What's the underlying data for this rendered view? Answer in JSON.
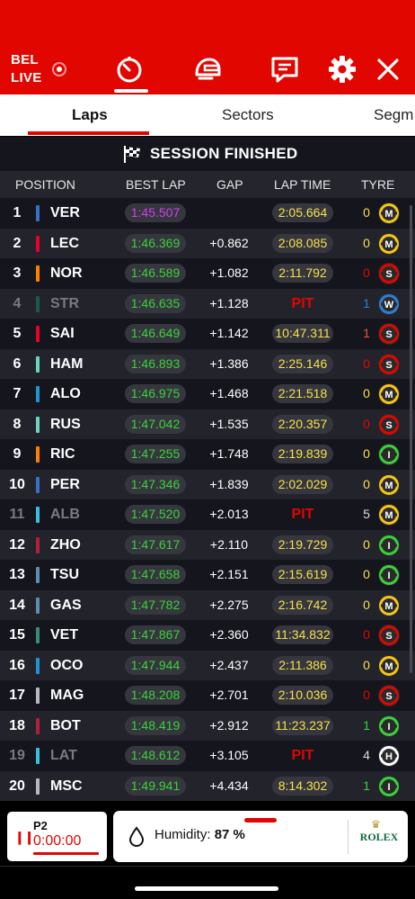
{
  "header": {
    "location": "BEL",
    "live_label": "LIVE",
    "icons": [
      "timer-icon",
      "helmet-icon",
      "chat-icon",
      "gear-icon",
      "close-icon"
    ]
  },
  "tabs": [
    {
      "label": "Laps",
      "active": true
    },
    {
      "label": "Sectors",
      "active": false
    },
    {
      "label": "Segm",
      "active": false
    }
  ],
  "session_status": "SESSION FINISHED",
  "table": {
    "columns": [
      "POSITION",
      "BEST LAP",
      "GAP",
      "LAP TIME",
      "TYRE"
    ],
    "rows": [
      {
        "pos": "1",
        "driver": "VER",
        "team_color": "#3671c6",
        "best": "1:45.507",
        "best_purple": true,
        "gap": "",
        "lap_time": "2:05.664",
        "pit": false,
        "tyre_laps": "0",
        "tyre": "M",
        "dim": false
      },
      {
        "pos": "2",
        "driver": "LEC",
        "team_color": "#e8002d",
        "best": "1:46.369",
        "best_purple": false,
        "gap": "+0.862",
        "lap_time": "2:08.085",
        "pit": false,
        "tyre_laps": "0",
        "tyre": "M",
        "dim": false
      },
      {
        "pos": "3",
        "driver": "NOR",
        "team_color": "#ff8000",
        "best": "1:46.589",
        "best_purple": false,
        "gap": "+1.082",
        "lap_time": "2:11.792",
        "pit": false,
        "tyre_laps": "0",
        "tyre": "S",
        "dim": false
      },
      {
        "pos": "4",
        "driver": "STR",
        "team_color": "#1a5a46",
        "best": "1:46.635",
        "best_purple": false,
        "gap": "+1.128",
        "lap_time": "PIT",
        "pit": true,
        "tyre_laps": "1",
        "tyre": "W",
        "dim": true
      },
      {
        "pos": "5",
        "driver": "SAI",
        "team_color": "#e8002d",
        "best": "1:46.649",
        "best_purple": false,
        "gap": "+1.142",
        "lap_time": "10:47.311",
        "pit": false,
        "tyre_laps": "1",
        "tyre": "S",
        "dim": false
      },
      {
        "pos": "6",
        "driver": "HAM",
        "team_color": "#6cd3bf",
        "best": "1:46.893",
        "best_purple": false,
        "gap": "+1.386",
        "lap_time": "2:25.146",
        "pit": false,
        "tyre_laps": "0",
        "tyre": "S",
        "dim": false
      },
      {
        "pos": "7",
        "driver": "ALO",
        "team_color": "#2293d1",
        "best": "1:46.975",
        "best_purple": false,
        "gap": "+1.468",
        "lap_time": "2:21.518",
        "pit": false,
        "tyre_laps": "0",
        "tyre": "M",
        "dim": false
      },
      {
        "pos": "8",
        "driver": "RUS",
        "team_color": "#6cd3bf",
        "best": "1:47.042",
        "best_purple": false,
        "gap": "+1.535",
        "lap_time": "2:20.357",
        "pit": false,
        "tyre_laps": "0",
        "tyre": "S",
        "dim": false
      },
      {
        "pos": "9",
        "driver": "RIC",
        "team_color": "#ff8000",
        "best": "1:47.255",
        "best_purple": false,
        "gap": "+1.748",
        "lap_time": "2:19.839",
        "pit": false,
        "tyre_laps": "0",
        "tyre": "I",
        "dim": false
      },
      {
        "pos": "10",
        "driver": "PER",
        "team_color": "#3671c6",
        "best": "1:47.346",
        "best_purple": false,
        "gap": "+1.839",
        "lap_time": "2:02.029",
        "pit": false,
        "tyre_laps": "0",
        "tyre": "M",
        "dim": false
      },
      {
        "pos": "11",
        "driver": "ALB",
        "team_color": "#37bedd",
        "best": "1:47.520",
        "best_purple": false,
        "gap": "+2.013",
        "lap_time": "PIT",
        "pit": true,
        "tyre_laps": "5",
        "tyre": "M",
        "dim": true
      },
      {
        "pos": "12",
        "driver": "ZHO",
        "team_color": "#b12039",
        "best": "1:47.617",
        "best_purple": false,
        "gap": "+2.110",
        "lap_time": "2:19.729",
        "pit": false,
        "tyre_laps": "0",
        "tyre": "I",
        "dim": false
      },
      {
        "pos": "13",
        "driver": "TSU",
        "team_color": "#5e8faa",
        "best": "1:47.658",
        "best_purple": false,
        "gap": "+2.151",
        "lap_time": "2:15.619",
        "pit": false,
        "tyre_laps": "0",
        "tyre": "I",
        "dim": false
      },
      {
        "pos": "14",
        "driver": "GAS",
        "team_color": "#5e8faa",
        "best": "1:47.782",
        "best_purple": false,
        "gap": "+2.275",
        "lap_time": "2:16.742",
        "pit": false,
        "tyre_laps": "0",
        "tyre": "M",
        "dim": false
      },
      {
        "pos": "15",
        "driver": "VET",
        "team_color": "#358c75",
        "best": "1:47.867",
        "best_purple": false,
        "gap": "+2.360",
        "lap_time": "11:34.832",
        "pit": false,
        "tyre_laps": "0",
        "tyre": "S",
        "dim": false
      },
      {
        "pos": "16",
        "driver": "OCO",
        "team_color": "#2293d1",
        "best": "1:47.944",
        "best_purple": false,
        "gap": "+2.437",
        "lap_time": "2:11.386",
        "pit": false,
        "tyre_laps": "0",
        "tyre": "M",
        "dim": false
      },
      {
        "pos": "17",
        "driver": "MAG",
        "team_color": "#b6babd",
        "best": "1:48.208",
        "best_purple": false,
        "gap": "+2.701",
        "lap_time": "2:10.036",
        "pit": false,
        "tyre_laps": "0",
        "tyre": "S",
        "dim": false
      },
      {
        "pos": "18",
        "driver": "BOT",
        "team_color": "#b12039",
        "best": "1:48.419",
        "best_purple": false,
        "gap": "+2.912",
        "lap_time": "11:23.237",
        "pit": false,
        "tyre_laps": "1",
        "tyre": "I",
        "dim": false
      },
      {
        "pos": "19",
        "driver": "LAT",
        "team_color": "#37bedd",
        "best": "1:48.612",
        "best_purple": false,
        "gap": "+3.105",
        "lap_time": "PIT",
        "pit": true,
        "tyre_laps": "4",
        "tyre": "H",
        "dim": true
      },
      {
        "pos": "20",
        "driver": "MSC",
        "team_color": "#b6babd",
        "best": "1:49.941",
        "best_purple": false,
        "gap": "+4.434",
        "lap_time": "8:14.302",
        "pit": false,
        "tyre_laps": "1",
        "tyre": "I",
        "dim": false
      }
    ]
  },
  "tyre_colors": {
    "S": "#e10600",
    "M": "#f5c518",
    "H": "#ffffff",
    "I": "#3ad23a",
    "W": "#2b7fd9"
  },
  "tyre_laps_colors": {
    "0": "#f5e04b",
    "1": "#3ad23a"
  },
  "session_card": {
    "label": "P2",
    "time": "0:00:00"
  },
  "weather": {
    "label": "Humidity:",
    "value": "87 %",
    "sponsor": "ROLEX"
  }
}
